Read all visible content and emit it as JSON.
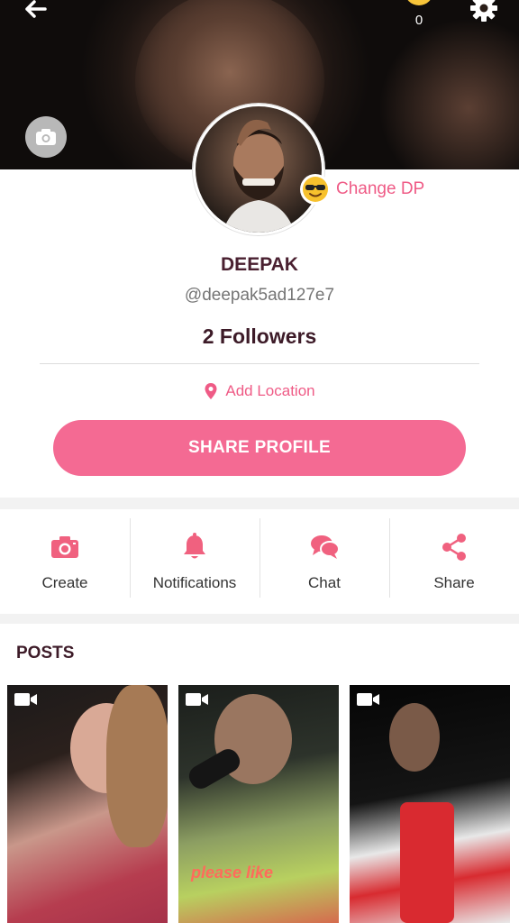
{
  "header": {
    "coin_count": "0"
  },
  "profile": {
    "change_dp_label": "Change DP",
    "name": "DEEPAK",
    "handle": "@deepak5ad127e7",
    "followers": "2 Followers",
    "location_label": "Add Location",
    "share_button_label": "SHARE PROFILE"
  },
  "actions": [
    {
      "label": "Create",
      "icon": "camera-icon"
    },
    {
      "label": "Notifications",
      "icon": "bell-icon"
    },
    {
      "label": "Chat",
      "icon": "chat-bubbles-icon"
    },
    {
      "label": "Share",
      "icon": "share-icon"
    }
  ],
  "posts": {
    "title": "POSTS",
    "items": [
      {
        "type": "video",
        "caption": ""
      },
      {
        "type": "video",
        "caption": "please like"
      },
      {
        "type": "video",
        "caption": ""
      }
    ]
  },
  "colors": {
    "accent": "#f46a93",
    "accent_text": "#ef5b86",
    "name_text": "#4a2030"
  }
}
